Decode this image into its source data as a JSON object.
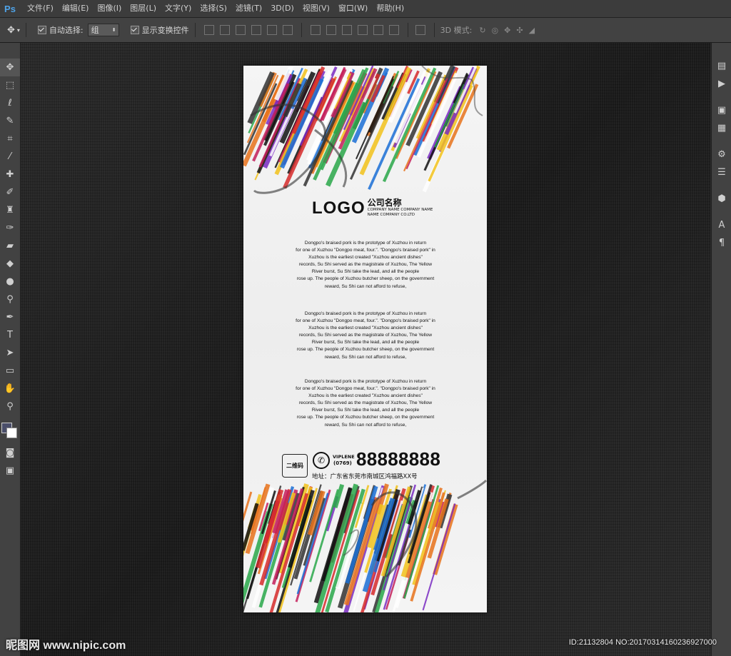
{
  "menu": {
    "app_logo": "Ps",
    "items": [
      "文件(F)",
      "编辑(E)",
      "图像(I)",
      "图层(L)",
      "文字(Y)",
      "选择(S)",
      "滤镜(T)",
      "3D(D)",
      "视图(V)",
      "窗口(W)",
      "帮助(H)"
    ]
  },
  "options": {
    "auto_select_label": "自动选择:",
    "auto_select_value": "组",
    "show_transform_label": "显示变换控件",
    "mode_3d_label": "3D 模式:"
  },
  "tools": [
    "move-icon",
    "marquee-icon",
    "lasso-icon",
    "quick-select-icon",
    "crop-icon",
    "eyedropper-icon",
    "healing-icon",
    "brush-icon",
    "stamp-icon",
    "history-brush-icon",
    "eraser-icon",
    "bucket-icon",
    "blur-icon",
    "dodge-icon",
    "pen-icon",
    "type-icon",
    "path-select-icon",
    "rectangle-icon",
    "hand-icon",
    "zoom-icon"
  ],
  "poster": {
    "logo": "LOGO",
    "company_name": "公司名称",
    "company_en_1": "COMPANY NAME COMPANY NAME",
    "company_en_2": "NAME COMPANY CO.LTD",
    "paragraph_lines": [
      "Dongpo's braised pork is the prototype of Xuzhou in return",
      "for one of Xuzhou \"Dongpo meat, four.\". \"Dongpo's braised pork\" in",
      "Xuzhou is the earliest created \"Xuzhou ancient dishes\"",
      "records, Su Shi served as the magistrate of Xuzhou, The Yellow",
      "River burst, Su Shi take the lead, and all the people",
      "rose up. The people of Xuzhou butcher sheep, on the government",
      "reward, Su Shi can not afford to refuse,"
    ],
    "qr_label": "二维码",
    "viplene": "VIPLENE",
    "area_code": "(0769)",
    "phone": "88888888",
    "address": "地址：广东省东莞市南城区鸿福路XX号"
  },
  "watermark": {
    "site": "昵图网 www.nipic.com",
    "id": "ID:21132804 NO:20170314160236927000"
  },
  "colors": {
    "menubar": "#3c3c3c",
    "panel": "#424242",
    "canvas_bg": "#222222",
    "ps_blue": "#4fa3e8"
  }
}
